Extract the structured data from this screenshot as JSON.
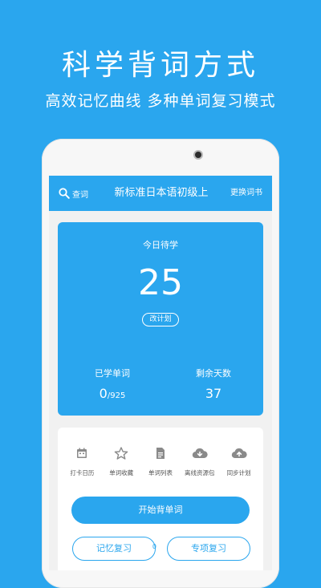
{
  "promo": {
    "headline": "科学背词方式",
    "subline": "高效记忆曲线 多种单词复习模式"
  },
  "appbar": {
    "search_label": "查词",
    "book_title": "新标准日本语初级上",
    "change_book_label": "更换词书"
  },
  "stats": {
    "today_label": "今日待学",
    "today_count": "25",
    "edit_plan_label": "改计划",
    "learned_label": "已学单词",
    "learned_value": "0",
    "learned_total": "/925",
    "remaining_label": "剩余天数",
    "remaining_value": "37"
  },
  "tools": [
    {
      "label": "打卡日历",
      "icon": "calendar-icon"
    },
    {
      "label": "单词收藏",
      "icon": "star-icon"
    },
    {
      "label": "单词列表",
      "icon": "document-icon"
    },
    {
      "label": "离线资源包",
      "icon": "cloud-download-icon"
    },
    {
      "label": "同步计划",
      "icon": "cloud-upload-icon"
    }
  ],
  "buttons": {
    "start_label": "开始背单词",
    "memory_review_label": "记忆复习",
    "memory_review_count": "0",
    "special_review_label": "专项复习"
  },
  "colors": {
    "brand_blue": "#2aa6ee",
    "icon_gray": "#8a8a8a"
  }
}
